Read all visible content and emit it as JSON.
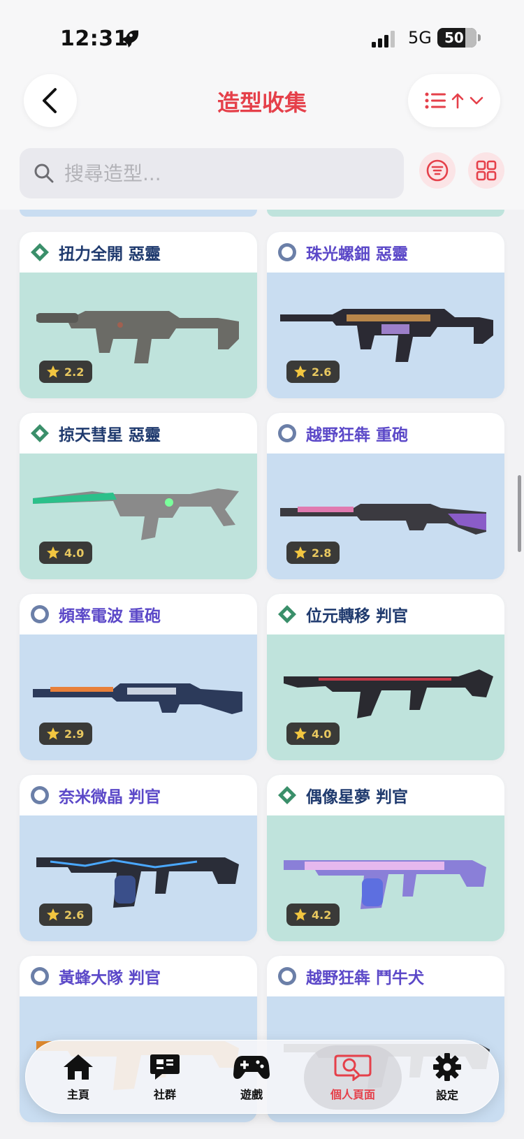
{
  "status_bar": {
    "time": "12:31",
    "network": "5G",
    "battery": "50"
  },
  "header": {
    "title": "造型收集"
  },
  "search": {
    "placeholder": "搜尋造型..."
  },
  "colors": {
    "accent": "#e5404a",
    "card_green": "#bfe3dc",
    "card_blue": "#c9ddf1",
    "title_green": "#1f3a6e",
    "title_blue": "#5b48c8",
    "badge_green": "#3a8f6a",
    "badge_blue": "#6b7fa8"
  },
  "skins": [
    {
      "name": "扭力全開 惡靈",
      "rating": "2.2",
      "theme": "green",
      "weapon": "smg-grey"
    },
    {
      "name": "珠光螺鈿 惡靈",
      "rating": "2.6",
      "theme": "blue",
      "weapon": "smg-dark"
    },
    {
      "name": "掠天彗星 惡靈",
      "rating": "4.0",
      "theme": "green",
      "weapon": "smg-neon"
    },
    {
      "name": "越野狂犇 重砲",
      "rating": "2.8",
      "theme": "blue",
      "weapon": "shotgun-pink"
    },
    {
      "name": "頻率電波 重砲",
      "rating": "2.9",
      "theme": "blue",
      "weapon": "shotgun-blue"
    },
    {
      "name": "位元轉移 判官",
      "rating": "4.0",
      "theme": "green",
      "weapon": "judge-black"
    },
    {
      "name": "奈米微晶 判官",
      "rating": "2.6",
      "theme": "blue",
      "weapon": "judge-electric"
    },
    {
      "name": "偶像星夢 判官",
      "rating": "4.2",
      "theme": "green",
      "weapon": "judge-idol"
    },
    {
      "name": "黃蜂大隊 判官",
      "rating": "",
      "theme": "blue",
      "weapon": "judge-hornet"
    },
    {
      "name": "越野狂犇 鬥牛犬",
      "rating": "",
      "theme": "blue",
      "weapon": "bulldog"
    }
  ],
  "tabbar": {
    "items": [
      {
        "label": "主頁",
        "icon": "home-icon"
      },
      {
        "label": "社群",
        "icon": "chat-icon"
      },
      {
        "label": "遊戲",
        "icon": "gamepad-icon"
      },
      {
        "label": "個人頁面",
        "icon": "profile-search-icon"
      },
      {
        "label": "設定",
        "icon": "gear-icon"
      }
    ],
    "active": 3
  }
}
